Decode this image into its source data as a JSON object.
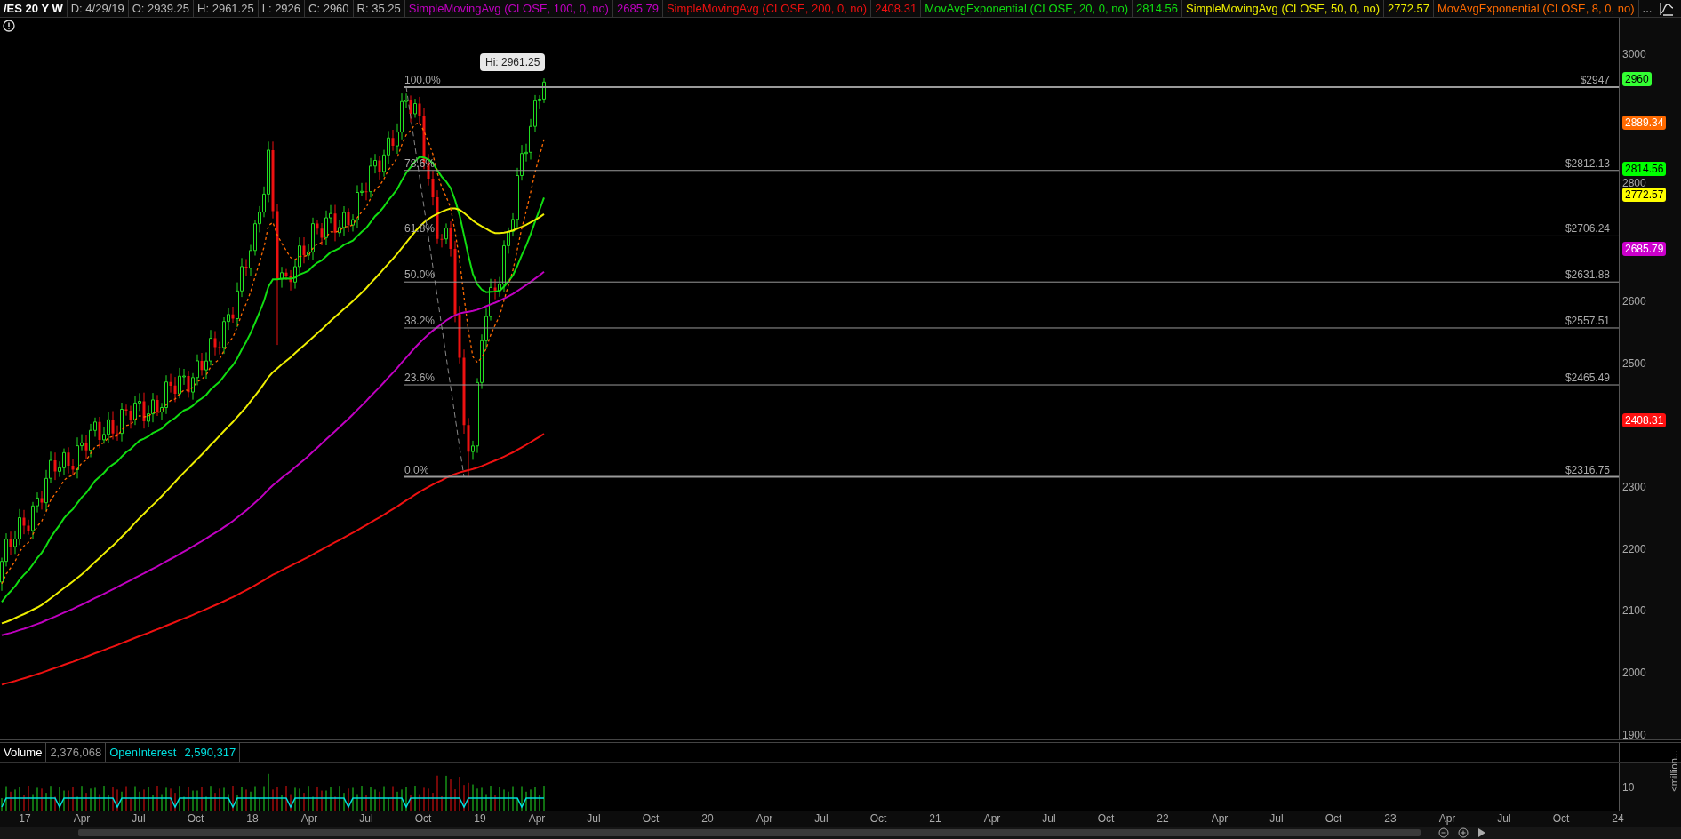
{
  "header": {
    "symbol": "/ES 20 Y W",
    "quotes": [
      "D: 4/29/19",
      "O: 2939.25",
      "H: 2961.25",
      "L: 2926",
      "C: 2960",
      "R: 35.25"
    ],
    "studies": [
      {
        "name": "SimpleMovingAvg (CLOSE, 100, 0, no)",
        "value": "2685.79",
        "color": "#c000c0"
      },
      {
        "name": "SimpleMovingAvg (CLOSE, 200, 0, no)",
        "value": "2408.31",
        "color": "#ee1111"
      },
      {
        "name": "MovAvgExponential (CLOSE, 20, 0, no)",
        "value": "2814.56",
        "color": "#11dd11"
      },
      {
        "name": "SimpleMovingAvg (CLOSE, 50, 0, no)",
        "value": "2772.57",
        "color": "#eeee00"
      },
      {
        "name": "MovAvgExponential (CLOSE, 8, 0, no)",
        "color": "#ff6a00"
      }
    ],
    "more": "..."
  },
  "price_chart": {
    "high_bubble": "Hi: 2961.25",
    "fib_levels": [
      {
        "percent": "100.0%",
        "price": "$2947"
      },
      {
        "percent": "78.6%",
        "price": "$2812.13"
      },
      {
        "percent": "61.8%",
        "price": "$2706.24"
      },
      {
        "percent": "50.0%",
        "price": "$2631.88"
      },
      {
        "percent": "38.2%",
        "price": "$2557.51"
      },
      {
        "percent": "23.6%",
        "price": "$2465.49"
      },
      {
        "percent": "0.0%",
        "price": "$2316.75"
      }
    ],
    "axis_labels": [
      "3000",
      "2800",
      "2600",
      "2500",
      "2300",
      "2200",
      "2100",
      "2000",
      "1900"
    ],
    "markers": [
      {
        "value": "2960",
        "color": "#33ff33"
      },
      {
        "value": "2889.34",
        "color": "#ff6a00"
      },
      {
        "value": "2814.56",
        "color": "#00ff00"
      },
      {
        "value": "2772.57",
        "color": "#ffff00"
      },
      {
        "value": "2685.79",
        "color": "#cc00cc"
      },
      {
        "value": "2408.31",
        "color": "#ff1111"
      }
    ]
  },
  "volume_panel": {
    "labels": [
      {
        "text": "Volume",
        "color": "#ffffff"
      },
      {
        "text": "2,376,068",
        "color": "#9a9a9a"
      },
      {
        "text": "OpenInterest",
        "color": "#00e0e0"
      },
      {
        "text": "2,590,317",
        "color": "#00e0e0"
      }
    ],
    "axis_labels": [
      "10"
    ],
    "unit": "<million..."
  },
  "time_axis": [
    "17",
    "Apr",
    "Jul",
    "Oct",
    "18",
    "Apr",
    "Jul",
    "Oct",
    "19",
    "Apr",
    "Jul",
    "Oct",
    "20",
    "Apr",
    "Jul",
    "Oct",
    "21",
    "Apr",
    "Jul",
    "Oct",
    "22",
    "Apr",
    "Jul",
    "Oct",
    "23",
    "Apr",
    "Jul",
    "Oct",
    "24"
  ]
}
